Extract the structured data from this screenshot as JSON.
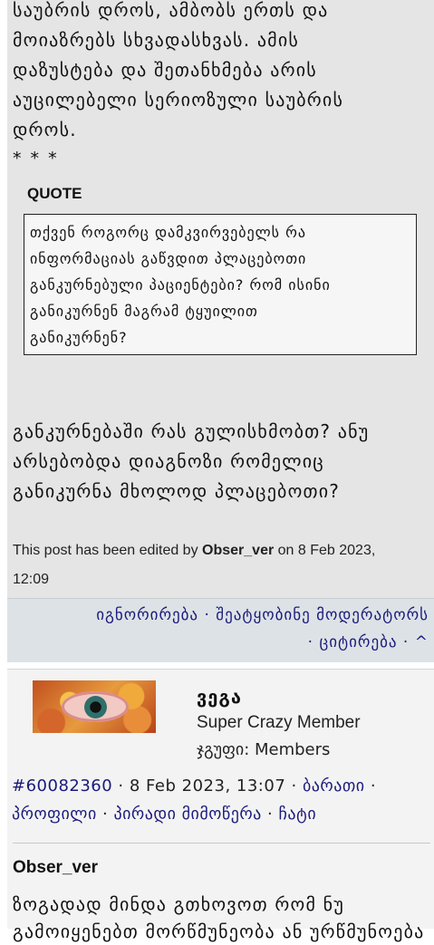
{
  "post1": {
    "text_lines": [
      "საუბრის დროს, ამბობს ერთს და",
      "მოიაზრებს სხვადასხვას. ამის",
      "დაზუსტება და შეთანხმება არის",
      "აუცილებელი სერიოზული საუბრის",
      "დროს."
    ],
    "stars": "* * *",
    "quote_label": "QUOTE",
    "quote_lines": [
      "თქვენ როგორც დამკვირვებელს რა",
      "ინფორმაციას გაწვდით პლაცებოთი",
      "განკურნებული პაციენტები? რომ ისინი",
      "განიკურნენ მაგრამ ტყუილით",
      "განიკურნენ?"
    ],
    "reply_lines": [
      "განკურნებაში რას გულისხმობთ? ანუ",
      "არსებობდა დიაგნოზი რომელიც",
      "განიკურნა მხოლოდ პლაცებოთი?"
    ],
    "edited": {
      "prefix": "This post has been edited by ",
      "editor": "Obser_ver",
      "suffix_line1": " on 8 Feb 2023,",
      "line2": "12:09"
    },
    "actions": {
      "ignore": "იგნორირება",
      "report": "შეატყობინე მოდერატორს",
      "quote": "ციტირება",
      "up": "^",
      "sep": " · "
    }
  },
  "post2": {
    "avatar_icon": "eye-avatar",
    "username": "ვეგა",
    "rank": "Super Crazy Member",
    "group": "ჯგუფი: Members",
    "post_id": "#60082360",
    "date": "8 Feb 2023, 13:07",
    "links": {
      "card": "ბარათი",
      "profile": "პროფილი",
      "pm": "პირადი მიმოწერა",
      "chat": "ჩატი"
    },
    "author": "Obser_ver",
    "text_lines": [
      "ზოგადად მინდა გთხოვოთ რომ ნუ",
      "გამოიყენებთ მორწმუნეობა ან ურწმუნოება"
    ]
  },
  "colors": {
    "post_bg": "#e5e5e5",
    "action_bar_bg": "#dde2e6",
    "link": "#1a1a7a",
    "post2_bg": "#f3f3f3"
  }
}
